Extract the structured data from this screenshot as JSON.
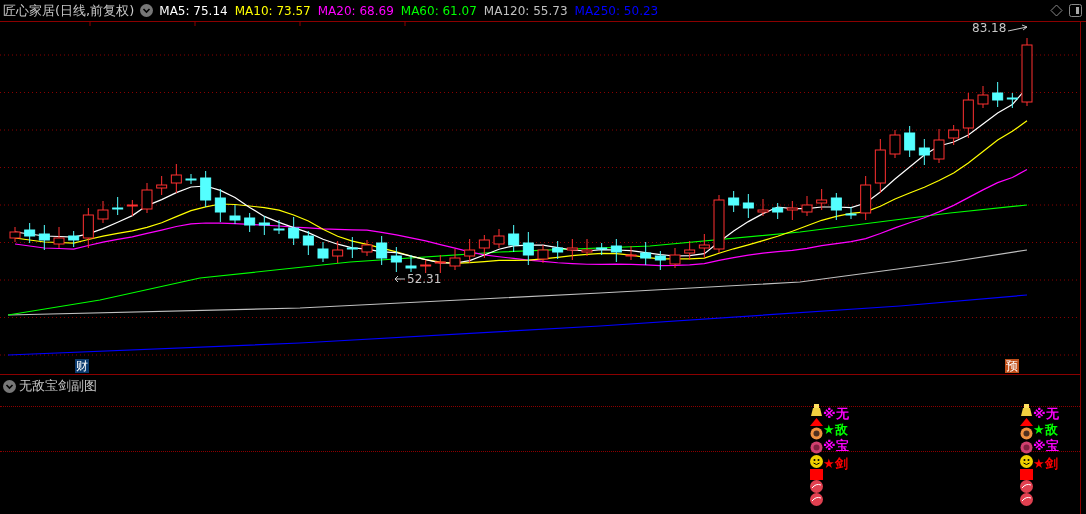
{
  "header": {
    "title": "匠心家居(日线,前复权)",
    "indicators": [
      {
        "label": "MA5: 75.14",
        "color": "#ffffff"
      },
      {
        "label": "MA10: 73.57",
        "color": "#ffff00"
      },
      {
        "label": "MA20: 68.69",
        "color": "#ff00ff"
      },
      {
        "label": "MA60: 61.07",
        "color": "#00ff00"
      },
      {
        "label": "MA120: 55.73",
        "color": "#c0c0c0"
      },
      {
        "label": "MA250: 50.23",
        "color": "#0000ff"
      }
    ]
  },
  "main_chart": {
    "price_labels": [
      {
        "text": "83.18",
        "kind": "high"
      },
      {
        "text": "52.31",
        "kind": "low"
      }
    ],
    "event_badges": [
      {
        "text": "财",
        "color": "#0b3a6e"
      },
      {
        "text": "预",
        "color": "#c0501a"
      }
    ]
  },
  "sub_chart": {
    "title": "无敌宝剑副图",
    "signals": [
      {
        "labels": [
          {
            "text": "※无",
            "color": "#ff00ff"
          },
          {
            "text": "★敌",
            "color": "#00ff00"
          },
          {
            "text": "※宝",
            "color": "#ff00ff"
          },
          {
            "text": "★剑",
            "color": "#ff0000"
          }
        ]
      },
      {
        "labels": [
          {
            "text": "※无",
            "color": "#ff00ff"
          },
          {
            "text": "★敌",
            "color": "#00ff00"
          },
          {
            "text": "※宝",
            "color": "#ff00ff"
          },
          {
            "text": "★剑",
            "color": "#ff0000"
          }
        ]
      }
    ]
  }
}
